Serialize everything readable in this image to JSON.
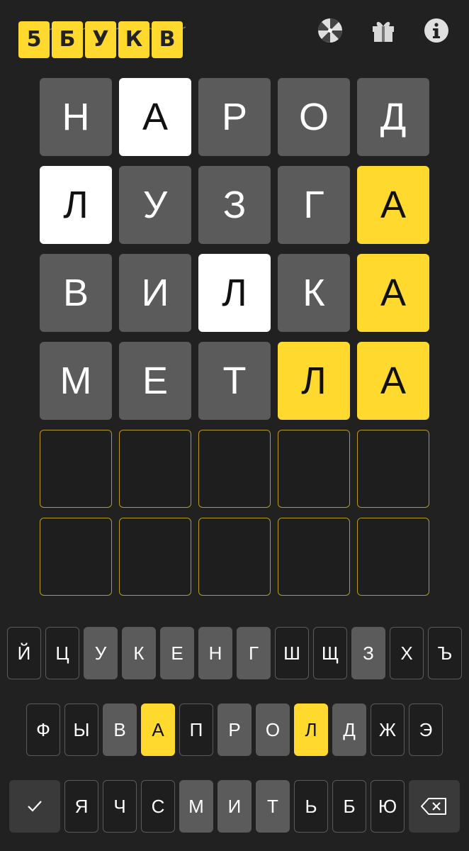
{
  "header": {
    "logo_letters": [
      "5",
      "Б",
      "У",
      "К",
      "В"
    ],
    "icons": [
      "palette-icon",
      "gift-icon",
      "info-icon"
    ]
  },
  "colors": {
    "background": "#212121",
    "absent": "#5b5b5b",
    "present": "#ffd92e",
    "highlight": "#ffffff",
    "empty_border": "#b59a1f"
  },
  "board": {
    "rows": [
      {
        "letters": [
          "Н",
          "А",
          "Р",
          "О",
          "Д"
        ],
        "states": [
          "absent",
          "white",
          "absent",
          "absent",
          "absent"
        ]
      },
      {
        "letters": [
          "Л",
          "У",
          "З",
          "Г",
          "А"
        ],
        "states": [
          "white",
          "absent",
          "absent",
          "absent",
          "yellow"
        ]
      },
      {
        "letters": [
          "В",
          "И",
          "Л",
          "К",
          "А"
        ],
        "states": [
          "absent",
          "absent",
          "white",
          "absent",
          "yellow"
        ]
      },
      {
        "letters": [
          "М",
          "Е",
          "Т",
          "Л",
          "А"
        ],
        "states": [
          "absent",
          "absent",
          "absent",
          "yellow",
          "yellow"
        ]
      },
      {
        "letters": [
          "",
          "",
          "",
          "",
          ""
        ],
        "states": [
          "empty",
          "empty",
          "empty",
          "empty",
          "empty"
        ]
      },
      {
        "letters": [
          "",
          "",
          "",
          "",
          ""
        ],
        "states": [
          "empty",
          "empty",
          "empty",
          "empty",
          "empty"
        ]
      }
    ]
  },
  "keyboard": {
    "rows": [
      [
        {
          "label": "Й",
          "state": "unused"
        },
        {
          "label": "Ц",
          "state": "unused"
        },
        {
          "label": "У",
          "state": "absent"
        },
        {
          "label": "К",
          "state": "absent"
        },
        {
          "label": "Е",
          "state": "absent"
        },
        {
          "label": "Н",
          "state": "absent"
        },
        {
          "label": "Г",
          "state": "absent"
        },
        {
          "label": "Ш",
          "state": "unused"
        },
        {
          "label": "Щ",
          "state": "unused"
        },
        {
          "label": "З",
          "state": "absent"
        },
        {
          "label": "Х",
          "state": "unused"
        },
        {
          "label": "Ъ",
          "state": "unused"
        }
      ],
      [
        {
          "label": "Ф",
          "state": "unused"
        },
        {
          "label": "Ы",
          "state": "unused"
        },
        {
          "label": "В",
          "state": "absent"
        },
        {
          "label": "А",
          "state": "present"
        },
        {
          "label": "П",
          "state": "unused"
        },
        {
          "label": "Р",
          "state": "absent"
        },
        {
          "label": "О",
          "state": "absent"
        },
        {
          "label": "Л",
          "state": "present"
        },
        {
          "label": "Д",
          "state": "absent"
        },
        {
          "label": "Ж",
          "state": "unused"
        },
        {
          "label": "Э",
          "state": "unused"
        }
      ],
      [
        {
          "label": "✓",
          "state": "enter"
        },
        {
          "label": "Я",
          "state": "unused"
        },
        {
          "label": "Ч",
          "state": "unused"
        },
        {
          "label": "С",
          "state": "unused"
        },
        {
          "label": "М",
          "state": "absent"
        },
        {
          "label": "И",
          "state": "absent"
        },
        {
          "label": "Т",
          "state": "absent"
        },
        {
          "label": "Ь",
          "state": "unused"
        },
        {
          "label": "Б",
          "state": "unused"
        },
        {
          "label": "Ю",
          "state": "unused"
        },
        {
          "label": "backspace-icon",
          "state": "backspace"
        }
      ]
    ]
  }
}
